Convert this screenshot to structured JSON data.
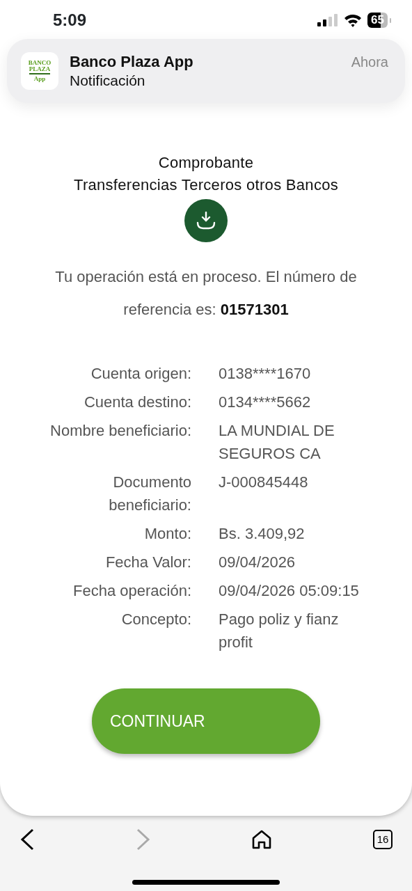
{
  "status_bar": {
    "time": "5:09",
    "battery": "65"
  },
  "notification": {
    "app_icon_lines": [
      "BANCO",
      "PLAZA",
      "App"
    ],
    "title": "Banco Plaza App",
    "body": "Notificación",
    "time": "Ahora"
  },
  "receipt": {
    "title": "Comprobante",
    "subtitle": "Transferencias Terceros otros Bancos",
    "message": "Tu operación está en proceso.  El número de referencia es: **01571301**",
    "details": [
      {
        "label": "Cuenta origen:",
        "value": "0138****1670"
      },
      {
        "label": "Cuenta destino:",
        "value": "0134****5662"
      },
      {
        "label": "Nombre beneficiario:",
        "value": "LA MUNDIAL DE SEGUROS CA"
      },
      {
        "label": "Documento beneficiario:",
        "value": "J-000845448"
      },
      {
        "label": "Monto:",
        "value": "Bs. 3.409,92"
      },
      {
        "label": "Fecha Valor:",
        "value": "09/04/2026"
      },
      {
        "label": "Fecha operación:",
        "value": "09/04/2026 05:09:15"
      },
      {
        "label": "Concepto:",
        "value": "Pago poliz y fianz profit"
      }
    ],
    "button": "CONTINUAR"
  },
  "toolbar": {
    "back_enabled": true,
    "forward_enabled": false,
    "tab_count": "16"
  }
}
